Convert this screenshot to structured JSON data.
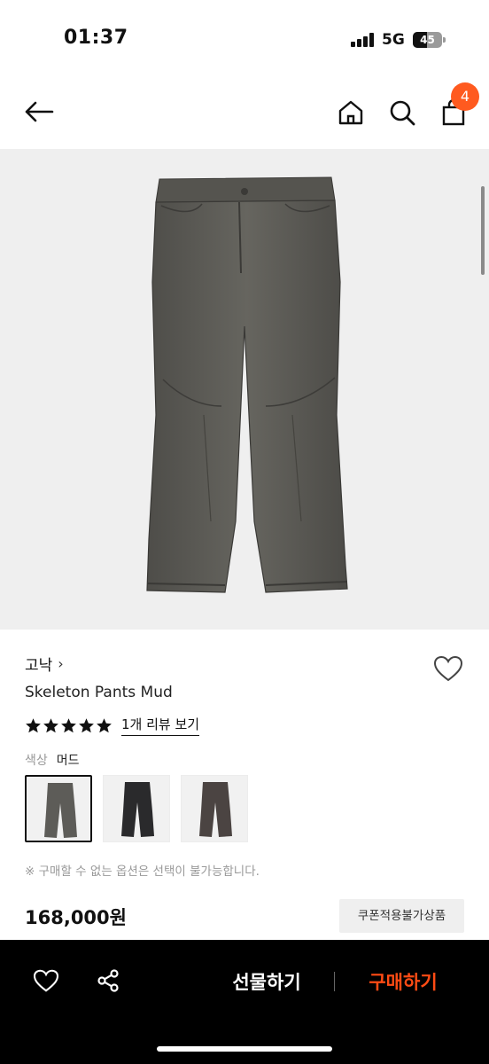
{
  "status": {
    "time": "01:37",
    "network": "5G",
    "battery": "45"
  },
  "header": {
    "cart_count": "4"
  },
  "product": {
    "brand": "고낙",
    "name": "Skeleton Pants Mud",
    "rating": 5,
    "review_link": "1개 리뷰 보기",
    "color_label": "색상",
    "color_value": "머드",
    "swatches": [
      "mud",
      "black",
      "brown"
    ],
    "notice": "※ 구매할 수 없는 옵션은 선택이 불가능합니다.",
    "price": "168,000원",
    "coupon_tag": "쿠폰적용불가상품"
  },
  "bottom_bar": {
    "gift_label": "선물하기",
    "buy_label": "구매하기"
  },
  "colors": {
    "accent": "#ff4b14",
    "badge": "#ff5a1f",
    "pants_mud": "#5d5c58",
    "pants_black": "#2a2a2c",
    "pants_brown": "#4b4442"
  }
}
